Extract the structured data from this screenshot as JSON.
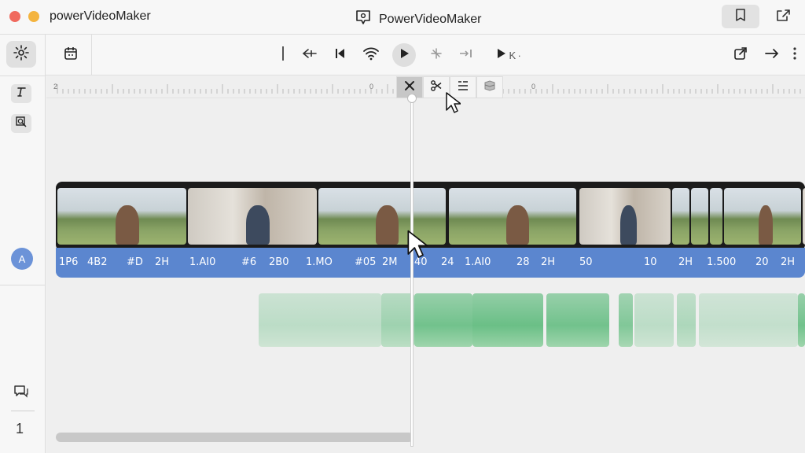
{
  "window": {
    "left_app_name": "powerVideoMaker",
    "title": "PowerVideoMaker"
  },
  "rail": {
    "avatar_letter": "A",
    "page_number": "1"
  },
  "toolbar": {
    "key_label": "K ∙"
  },
  "ruler": {
    "labels": [
      "2",
      "0",
      "0"
    ]
  },
  "timeline": {
    "frame_labels": [
      "1P6",
      "4B2",
      "#D",
      "2H",
      "1.AI0",
      "#6",
      "2B0",
      "1.MO",
      "#05",
      "2M",
      "40",
      "24",
      "1.AI0",
      "28",
      "2H",
      "50",
      "10",
      "2H",
      "1.500",
      "20",
      "2H"
    ]
  },
  "colors": {
    "track_blue": "#5b86cf",
    "audio_green": "#5cba7b",
    "avatar": "#6c93d8"
  }
}
